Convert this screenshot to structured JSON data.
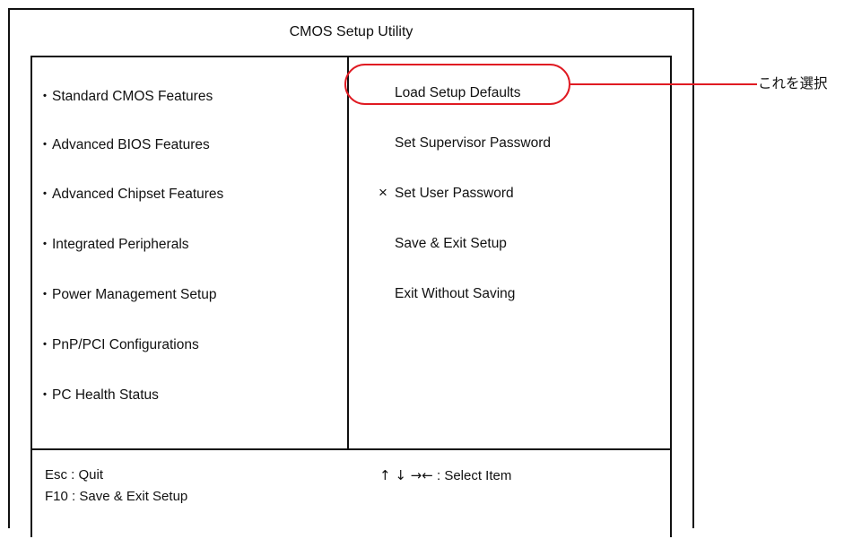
{
  "header": {
    "title": "CMOS Setup Utility"
  },
  "left_menu": {
    "bullet": "・",
    "items": [
      "Standard CMOS Features",
      "Advanced BIOS Features",
      "Advanced Chipset Features",
      "Integrated Peripherals",
      "Power Management Setup",
      "PnP/PCI Configurations",
      "PC Health Status"
    ]
  },
  "right_menu": {
    "items": [
      "Load Setup Defaults",
      "Set Supervisor Password",
      "Set User Password",
      "Save & Exit Setup",
      "Exit Without Saving"
    ],
    "x_mark": "×"
  },
  "footer": {
    "esc_key": "Esc : Quit",
    "f10_key": "F10 : Save & Exit Setup",
    "arrows": "↑ ↓ →←",
    "select_label": " : Select Item"
  },
  "annotation": {
    "text": "これを選択",
    "color": "#e01a22"
  }
}
